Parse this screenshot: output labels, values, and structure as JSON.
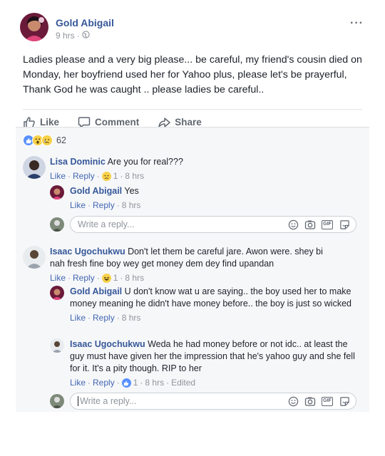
{
  "post": {
    "author": "Gold Abigail",
    "time": "9 hrs",
    "separator": "·",
    "text": "Ladies please and a very big please... be careful, my friend's cousin died on Monday, her boyfriend used her for Yahoo plus, please let's be prayerful, Thank God he was caught .. please ladies be careful..",
    "more_label": "···"
  },
  "actions": {
    "like": "Like",
    "comment": "Comment",
    "share": "Share"
  },
  "reactions": {
    "count": "62",
    "icons": [
      "like-icon",
      "wow-icon",
      "sad-icon"
    ]
  },
  "thread1": {
    "comment": {
      "name": "Lisa Dominic",
      "text": "Are you for real???",
      "like": "Like",
      "reply": "Reply",
      "react_count": "1",
      "time": "8 hrs"
    },
    "reply": {
      "name": "Gold Abigail",
      "text": "Yes",
      "like": "Like",
      "reply": "Reply",
      "time": "8 hrs"
    },
    "reply_box": {
      "placeholder": "Write a reply..."
    }
  },
  "thread2": {
    "comment": {
      "name": "Isaac Ugochukwu",
      "text": "Don't let them be careful jare. Awon were. shey bi nah fresh fine boy wey get money dem dey find upandan",
      "like": "Like",
      "reply": "Reply",
      "react_count": "1",
      "time": "8 hrs"
    },
    "reply1": {
      "name": "Gold Abigail",
      "text": "U don't know wat u are saying.. the boy used her to make money meaning he didn't have money before.. the boy is just so wicked",
      "like": "Like",
      "reply": "Reply",
      "time": "8 hrs"
    },
    "reply2": {
      "name": "Isaac Ugochukwu",
      "text": "Weda he had money before or not idc.. at least the guy must have given her the impression that he's yahoo guy and she fell for it. It's a pity though. RIP to her",
      "like": "Like",
      "reply": "Reply",
      "react_count": "1",
      "time": "8 hrs",
      "edited": "Edited"
    },
    "reply_box": {
      "placeholder": "Write a reply..."
    }
  },
  "reply_icons": {
    "gif_label": "GIF"
  },
  "colors": {
    "link": "#365899",
    "meta": "#90949c",
    "background": "#f6f7f9",
    "like_blue": "#5890ff"
  }
}
